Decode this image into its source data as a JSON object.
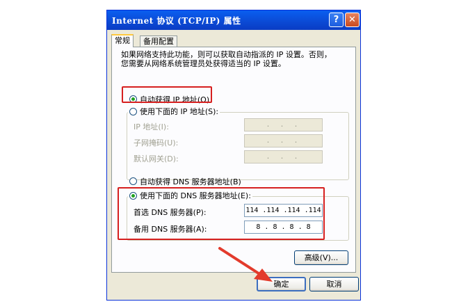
{
  "window": {
    "title": "Internet 协议 (TCP/IP) 属性",
    "help_glyph": "?",
    "close_glyph": "✕"
  },
  "tabs": [
    {
      "label": "常规",
      "active": true
    },
    {
      "label": "备用配置",
      "active": false
    }
  ],
  "intro": {
    "line1": "如果网络支持此功能，则可以获取自动指派的 IP 设置。否则，",
    "line2": "您需要从网络系统管理员处获得适当的 IP 设置。"
  },
  "ip_mode": {
    "auto_label": "自动获得 IP 地址(O)",
    "manual_label": "使用下面的 IP 地址(S):",
    "selected": "auto"
  },
  "ip_fields": [
    {
      "label": "IP 地址(I):",
      "value": ". . ."
    },
    {
      "label": "子网掩码(U):",
      "value": ". . ."
    },
    {
      "label": "默认网关(D):",
      "value": ". . ."
    }
  ],
  "dns_mode": {
    "auto_label": "自动获得 DNS 服务器地址(B)",
    "manual_label": "使用下面的 DNS 服务器地址(E):",
    "selected": "manual"
  },
  "dns_fields": [
    {
      "label": "首选 DNS 服务器(P):",
      "value": "114 .114 .114 .114"
    },
    {
      "label": "备用 DNS 服务器(A):",
      "value": "8  .  8  .  8  .  8"
    }
  ],
  "buttons": {
    "advanced": "高级(V)...",
    "ok": "确定",
    "cancel": "取消"
  },
  "annotation": {
    "highlight_color": "#d61f1f"
  }
}
